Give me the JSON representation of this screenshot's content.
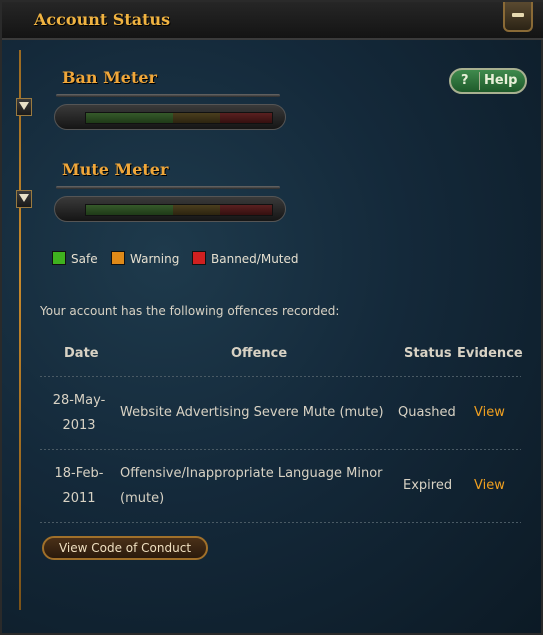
{
  "window": {
    "title": "Account Status",
    "minimize_icon": "minimize-icon"
  },
  "help_button": {
    "icon": "?",
    "label": "Help"
  },
  "ban_meter": {
    "title": "Ban Meter",
    "level": 0
  },
  "mute_meter": {
    "title": "Mute Meter",
    "level": 0
  },
  "legend": [
    {
      "label": "Safe",
      "color": "#3fb21f"
    },
    {
      "label": "Warning",
      "color": "#e08a18"
    },
    {
      "label": "Banned/Muted",
      "color": "#d02020"
    }
  ],
  "intro_text": "Your account has the following offences recorded:",
  "table": {
    "headers": {
      "date": "Date",
      "offence": "Offence",
      "status": "Status",
      "evidence": "Evidence"
    },
    "rows": [
      {
        "date_line1": "28-May-",
        "date_line2": "2013",
        "offence_line1": "Website Advertising Severe Mute (mute)",
        "offence_line2": "",
        "status": "Quashed",
        "evidence": "View"
      },
      {
        "date_line1": "18-Feb-",
        "date_line2": "2011",
        "offence_line1": "Offensive/Inappropriate Language Minor",
        "offence_line2": "(mute)",
        "status": "Expired",
        "evidence": "View"
      }
    ]
  },
  "code_of_conduct_button": "View Code of Conduct"
}
